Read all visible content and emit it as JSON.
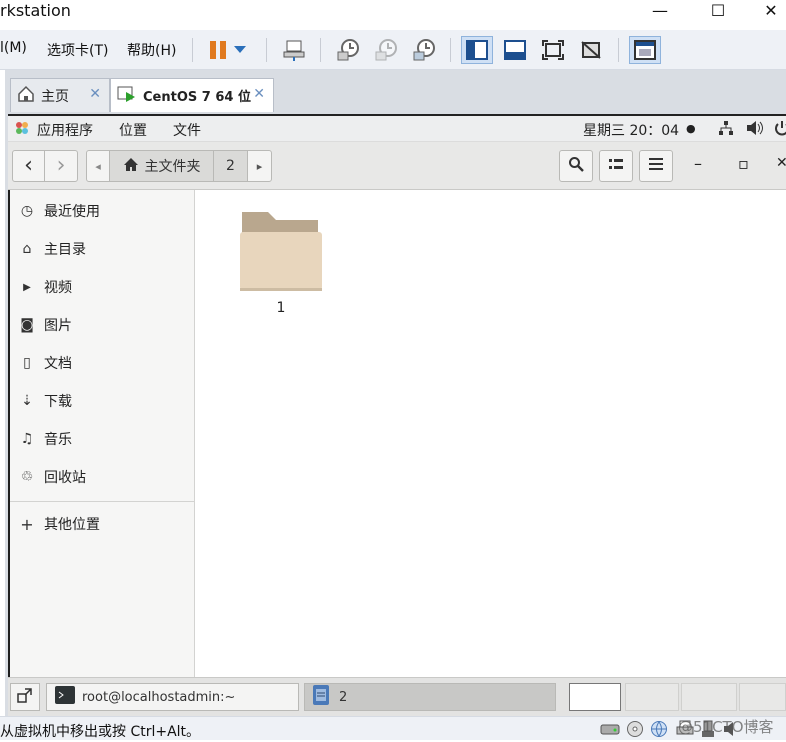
{
  "window": {
    "title": "rkstation",
    "minimize": "—",
    "maximize": "☐",
    "close": "✕"
  },
  "vm_menu": {
    "items": [
      "l(M)",
      "选项卡(T)",
      "帮助(H)"
    ]
  },
  "vm_tabs": [
    {
      "label": "主页",
      "close": "✕"
    },
    {
      "label": "CentOS 7 64 位",
      "close": "✕"
    }
  ],
  "guest_topbar": {
    "apps": "应用程序",
    "places": "位置",
    "files": "文件",
    "clock": "星期三 20：04",
    "dot": "●"
  },
  "files_header": {
    "back": "‹",
    "forward": "›",
    "path_left": "◂",
    "path_home": "主文件夹",
    "path_current": "2",
    "path_right": "▸",
    "minimize": "–",
    "maximize": "▫",
    "close": "✕"
  },
  "sidebar": {
    "items": [
      {
        "label": "最近使用",
        "icon": "◷"
      },
      {
        "label": "主目录",
        "icon": "⌂"
      },
      {
        "label": "视频",
        "icon": "▶"
      },
      {
        "label": "图片",
        "icon": "◙"
      },
      {
        "label": "文档",
        "icon": "▯"
      },
      {
        "label": "下载",
        "icon": "⇣"
      },
      {
        "label": "音乐",
        "icon": "♫"
      },
      {
        "label": "回收站",
        "icon": "♲"
      }
    ],
    "other": {
      "label": "其他位置",
      "icon": "+"
    }
  },
  "files": [
    {
      "name": "1"
    }
  ],
  "taskbar": {
    "terminal": "root@localhostadmin:~",
    "window": "2"
  },
  "status": {
    "text": "从虚拟机中移出或按 Ctrl+Alt。",
    "watermark": "@51CTO博客"
  },
  "colors": {
    "folder_body": "#e8d6bd",
    "folder_tab": "#b9a78e",
    "accent": "#2a6fba"
  }
}
